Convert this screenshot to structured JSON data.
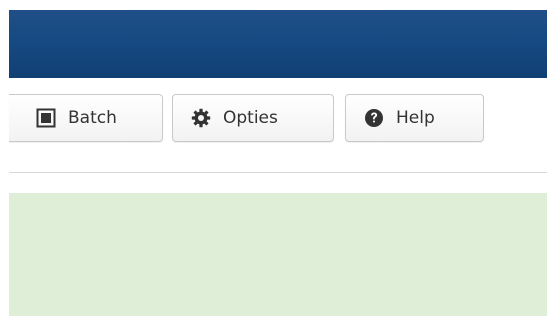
{
  "toolbar": {
    "buttons": [
      {
        "label": "Batch",
        "icon": "batch-icon"
      },
      {
        "label": "Opties",
        "icon": "gear-icon"
      },
      {
        "label": "Help",
        "icon": "help-icon"
      }
    ]
  },
  "colors": {
    "header": "#174a82",
    "notice": "#dfeed6",
    "button_border": "#c9c9c9",
    "text": "#333333"
  }
}
